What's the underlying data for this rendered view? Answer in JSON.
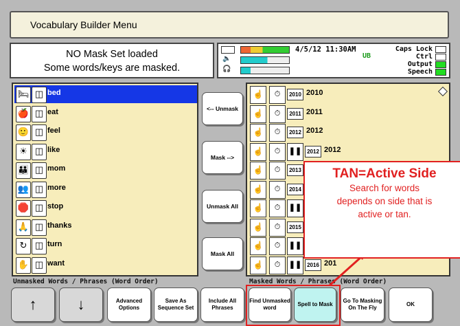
{
  "title": "Vocabulary Builder Menu",
  "message": {
    "line1": "NO Mask Set loaded",
    "line2": "Some words/keys are masked."
  },
  "status": {
    "datetime": "4/5/12 11:30AM",
    "ub": "UB",
    "locks": [
      {
        "label": "Caps Lock",
        "on": false
      },
      {
        "label": "Ctrl",
        "on": false
      },
      {
        "label": "Output",
        "on": true
      },
      {
        "label": "Speech",
        "on": true
      }
    ]
  },
  "left_list": [
    {
      "label": "bed",
      "selected": true,
      "icon1": "bed-icon",
      "icon2": "bed-symbol-icon"
    },
    {
      "label": "eat",
      "selected": false,
      "icon1": "apple-icon",
      "icon2": "eat-symbol-icon"
    },
    {
      "label": "feel",
      "selected": false,
      "icon1": "faces-icon",
      "icon2": "feel-symbol-icon"
    },
    {
      "label": "like",
      "selected": false,
      "icon1": "sun-icon",
      "icon2": "like-symbol-icon"
    },
    {
      "label": "mom",
      "selected": false,
      "icon1": "family-icon",
      "icon2": "mom-symbol-icon"
    },
    {
      "label": "more",
      "selected": false,
      "icon1": "people-icon",
      "icon2": "more-symbol-icon"
    },
    {
      "label": "stop",
      "selected": false,
      "icon1": "stop-sign-icon",
      "icon2": "stop-symbol-icon"
    },
    {
      "label": "thanks",
      "selected": false,
      "icon1": "thanks-icon",
      "icon2": "thanks-symbol-icon"
    },
    {
      "label": "turn",
      "selected": false,
      "icon1": "turn-icon",
      "icon2": "turn-symbol-icon"
    },
    {
      "label": "want",
      "selected": false,
      "icon1": "want-icon",
      "icon2": "want-symbol-icon"
    }
  ],
  "right_list": [
    {
      "box": "2010",
      "label": "2010",
      "pause": false
    },
    {
      "box": "2011",
      "label": "2011",
      "pause": false
    },
    {
      "box": "2012",
      "label": "2012",
      "pause": false
    },
    {
      "box": "2012",
      "label": "2012",
      "pause": true
    },
    {
      "box": "2013",
      "label": "",
      "pause": false
    },
    {
      "box": "2014",
      "label": "",
      "pause": false
    },
    {
      "box": "",
      "label": "",
      "pause": true
    },
    {
      "box": "2015",
      "label": "",
      "pause": false
    },
    {
      "box": "",
      "label": "",
      "pause": true
    },
    {
      "box": "2016",
      "label": "201",
      "pause": true
    }
  ],
  "mid_buttons": {
    "unmask": "<-- Unmask",
    "mask": "Mask -->",
    "unmask_all": "Unmask All",
    "mask_all": "Mask All"
  },
  "captions": {
    "left": "Unmasked Words / Phrases (Word Order)",
    "right": "Masked Words / Phrases (Word Order)"
  },
  "bottom_buttons": {
    "up": "↑",
    "down": "↓",
    "advanced": "Advanced Options",
    "save_seq": "Save As Sequence Set",
    "include_all": "Include All Phrases",
    "find_unmasked": "Find Unmasked word",
    "spell_mask": "Spell to Mask",
    "goto_masking": "Go To Masking On The Fly",
    "ok": "OK"
  },
  "callout": {
    "heading": "TAN=Active Side",
    "line1": "Search for words",
    "line2": "depends on side that is",
    "line3": "active or tan."
  }
}
